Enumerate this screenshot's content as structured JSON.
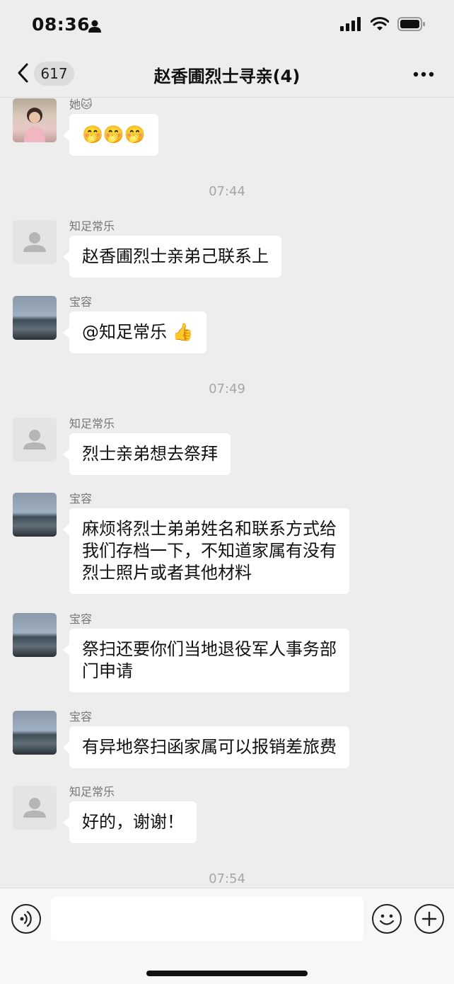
{
  "status_bar": {
    "time": "08:36"
  },
  "nav": {
    "unread_count": "617",
    "title": "赵香圃烈士寻亲(4)"
  },
  "messages": [
    {
      "sender": "她🐱",
      "text": "🤭🤭🤭"
    },
    {
      "timestamp": "07:44"
    },
    {
      "sender": "知足常乐",
      "text": "赵香圃烈士亲弟己联系上"
    },
    {
      "sender": "宝容",
      "text": "@知足常乐 👍"
    },
    {
      "timestamp": "07:49"
    },
    {
      "sender": "知足常乐",
      "text": "烈士亲弟想去祭拜"
    },
    {
      "sender": "宝容",
      "lines": [
        "麻烦将烈士弟弟姓名和联系方式给",
        "我们存档一下，不知道家属有没有",
        "烈士照片或者其他材料"
      ]
    },
    {
      "sender": "宝容",
      "lines": [
        "祭扫还要你们当地退役军人事务部",
        "门申请"
      ]
    },
    {
      "sender": "宝容",
      "text": "有异地祭扫函家属可以报销差旅费"
    },
    {
      "sender": "知足常乐",
      "text": "好的，谢谢！"
    },
    {
      "timestamp": "07:54"
    }
  ],
  "icons": {
    "status": [
      "person-icon",
      "signal-icon",
      "wifi-icon",
      "battery-icon"
    ],
    "nav": [
      "back-chevron-icon",
      "more-icon"
    ],
    "input": [
      "voice-icon",
      "emoji-icon",
      "add-icon"
    ]
  }
}
